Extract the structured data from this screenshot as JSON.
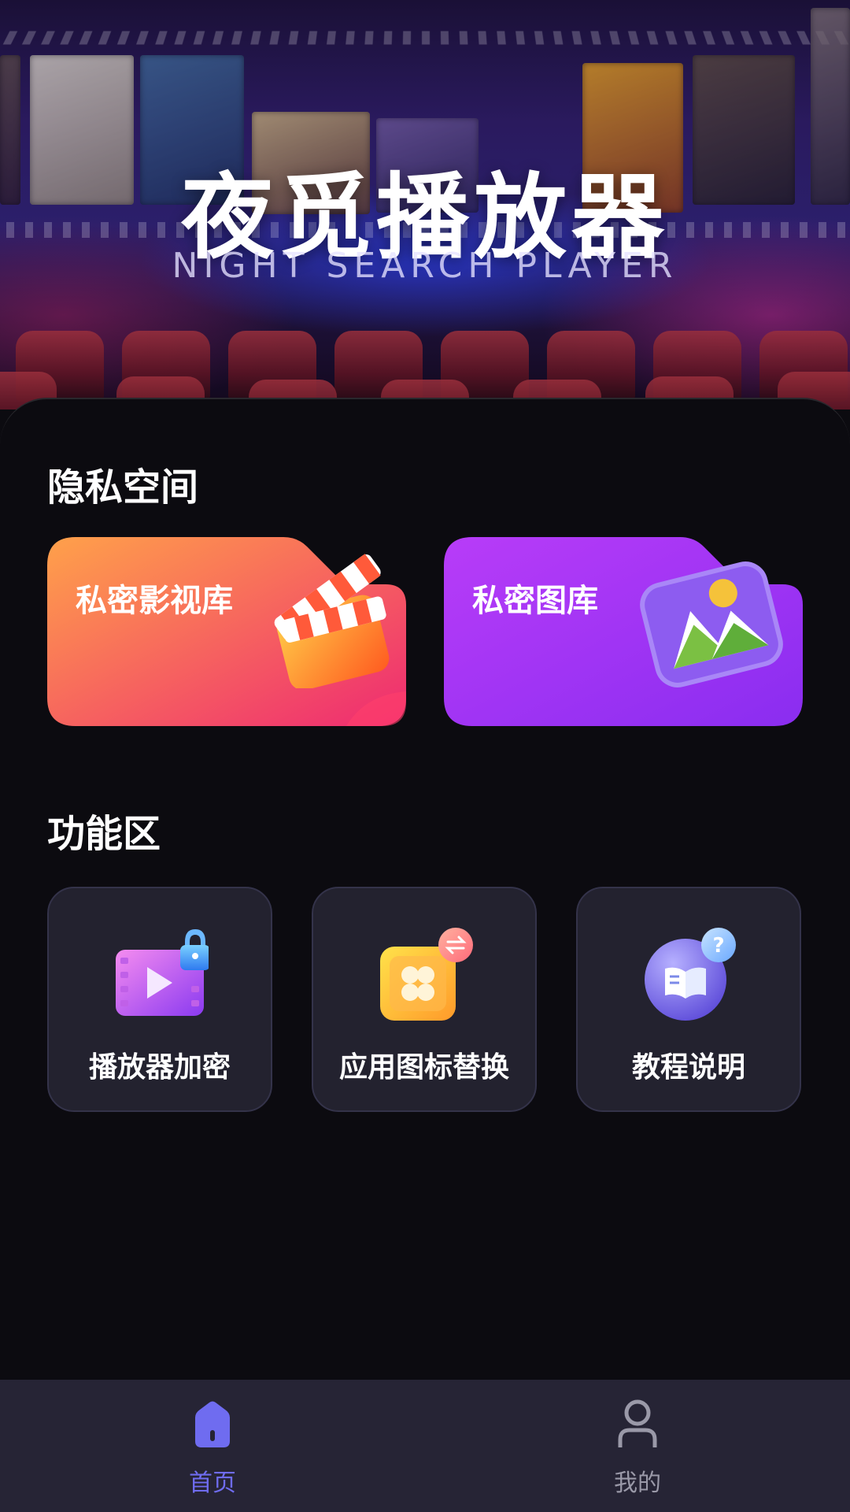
{
  "hero": {
    "title": "夜觅播放器",
    "subtitle": "NIGHT SEARCH PLAYER"
  },
  "private_space": {
    "title": "隐私空间",
    "cards": [
      {
        "label": "私密影视库",
        "icon": "clapperboard-icon",
        "color_start": "#ff9a4a",
        "color_end": "#f0286e"
      },
      {
        "label": "私密图库",
        "icon": "image-gallery-icon",
        "color_start": "#b23cf6",
        "color_end": "#8a2cf0"
      }
    ]
  },
  "features": {
    "title": "功能区",
    "items": [
      {
        "label": "播放器加密",
        "icon": "video-lock-icon"
      },
      {
        "label": "应用图标替换",
        "icon": "app-icon-swap-icon"
      },
      {
        "label": "教程说明",
        "icon": "tutorial-book-icon"
      }
    ]
  },
  "tabbar": {
    "items": [
      {
        "label": "首页",
        "icon": "home-icon",
        "active": true,
        "color": "#6f6cf0"
      },
      {
        "label": "我的",
        "icon": "user-icon",
        "active": false,
        "color": "#9a99a8"
      }
    ]
  }
}
